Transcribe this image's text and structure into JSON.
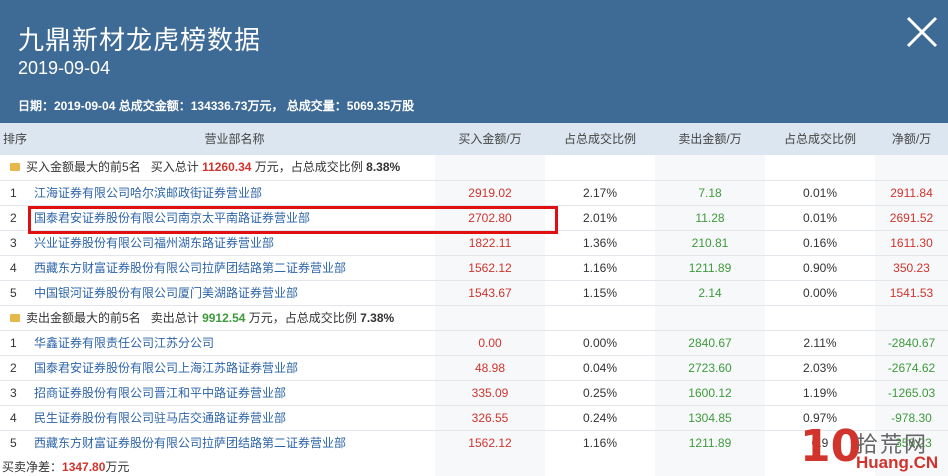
{
  "header": {
    "title": "九鼎新材龙虎榜数据",
    "date": "2019-09-04",
    "summary": "日期：2019-09-04 总成交金额：134336.73万元， 总成交量：5069.35万股"
  },
  "columns": [
    "排序",
    "营业部名称",
    "买入金额/万",
    "占总成交比例",
    "卖出金额/万",
    "占总成交比例",
    "净额/万"
  ],
  "buy_group": {
    "label": "买入金额最大的前5名",
    "total_label": "买入总计",
    "total": "11260.34",
    "unit_label": "万元，占总成交比例",
    "ratio": "8.38%"
  },
  "buy_rows": [
    {
      "rank": "1",
      "name": "江海证券有限公司哈尔滨邮政街证券营业部",
      "buy": "2919.02",
      "buy_ratio": "2.17%",
      "sell": "7.18",
      "sell_ratio": "0.01%",
      "net": "2911.84"
    },
    {
      "rank": "2",
      "name": "国泰君安证券股份有限公司南京太平南路证券营业部",
      "buy": "2702.80",
      "buy_ratio": "2.01%",
      "sell": "11.28",
      "sell_ratio": "0.01%",
      "net": "2691.52"
    },
    {
      "rank": "3",
      "name": "兴业证券股份有限公司福州湖东路证券营业部",
      "buy": "1822.11",
      "buy_ratio": "1.36%",
      "sell": "210.81",
      "sell_ratio": "0.16%",
      "net": "1611.30"
    },
    {
      "rank": "4",
      "name": "西藏东方财富证券股份有限公司拉萨团结路第二证券营业部",
      "buy": "1562.12",
      "buy_ratio": "1.16%",
      "sell": "1211.89",
      "sell_ratio": "0.90%",
      "net": "350.23"
    },
    {
      "rank": "5",
      "name": "中国银河证券股份有限公司厦门美湖路证券营业部",
      "buy": "1543.67",
      "buy_ratio": "1.15%",
      "sell": "2.14",
      "sell_ratio": "0.00%",
      "net": "1541.53"
    }
  ],
  "sell_group": {
    "label": "卖出金额最大的前5名",
    "total_label": "卖出总计",
    "total": "9912.54",
    "unit_label": "万元，占总成交比例",
    "ratio": "7.38%"
  },
  "sell_rows": [
    {
      "rank": "1",
      "name": "华鑫证券有限责任公司江苏分公司",
      "buy": "0.00",
      "buy_ratio": "0.00%",
      "sell": "2840.67",
      "sell_ratio": "2.11%",
      "net": "-2840.67"
    },
    {
      "rank": "2",
      "name": "国泰君安证券股份有限公司上海江苏路证券营业部",
      "buy": "48.98",
      "buy_ratio": "0.04%",
      "sell": "2723.60",
      "sell_ratio": "2.03%",
      "net": "-2674.62"
    },
    {
      "rank": "3",
      "name": "招商证券股份有限公司晋江和平中路证券营业部",
      "buy": "335.09",
      "buy_ratio": "0.25%",
      "sell": "1600.12",
      "sell_ratio": "1.19%",
      "net": "-1265.03"
    },
    {
      "rank": "4",
      "name": "民生证券股份有限公司驻马店交通路证券营业部",
      "buy": "326.55",
      "buy_ratio": "0.24%",
      "sell": "1304.85",
      "sell_ratio": "0.97%",
      "net": "-978.30"
    },
    {
      "rank": "5",
      "name": "西藏东方财富证券股份有限公司拉萨团结路第二证券营业部",
      "buy": "1562.12",
      "buy_ratio": "1.16%",
      "sell": "1211.89",
      "sell_ratio": "0.9",
      "net": "-350.23"
    }
  ],
  "footer": {
    "label": "买卖净差：",
    "value": "1347.80",
    "unit": "万元"
  },
  "watermark": {
    "mark": "10",
    "cn": "拾荒网",
    "en": "Huang.CN"
  },
  "colors": {
    "header_bg": "#3e6a96",
    "positive": "#d0342c",
    "negative": "#3f9a3c",
    "link": "#2d64a7",
    "highlight": "#e01010"
  },
  "icons": {
    "close": "close-icon",
    "group": "folder-icon"
  }
}
